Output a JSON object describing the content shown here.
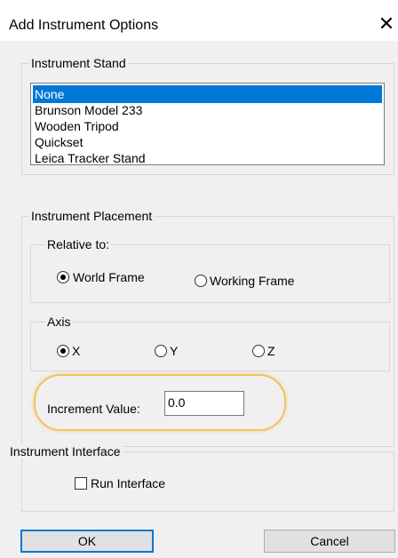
{
  "window": {
    "title": "Add Instrument Options",
    "close_glyph": "✕"
  },
  "instrument_stand": {
    "legend": "Instrument Stand",
    "items": [
      "None",
      "Brunson Model 233",
      "Wooden Tripod",
      "Quickset",
      "Leica Tracker Stand"
    ],
    "selected": "None"
  },
  "placement": {
    "legend": "Instrument Placement",
    "relative": {
      "legend": "Relative to:",
      "options": [
        "World Frame",
        "Working Frame"
      ],
      "selected": "World Frame"
    },
    "axis": {
      "legend": "Axis",
      "options": [
        "X",
        "Y",
        "Z"
      ],
      "selected": "X"
    },
    "increment": {
      "label": "Increment Value:",
      "value": "0.0"
    }
  },
  "interface": {
    "legend": "Instrument Interface",
    "run_label": "Run Interface",
    "run_checked": false
  },
  "buttons": {
    "ok": "OK",
    "cancel": "Cancel"
  },
  "colors": {
    "selection": "#0078d7",
    "highlight": "#f0c35a",
    "dialog_bg": "#f0f0f0"
  }
}
